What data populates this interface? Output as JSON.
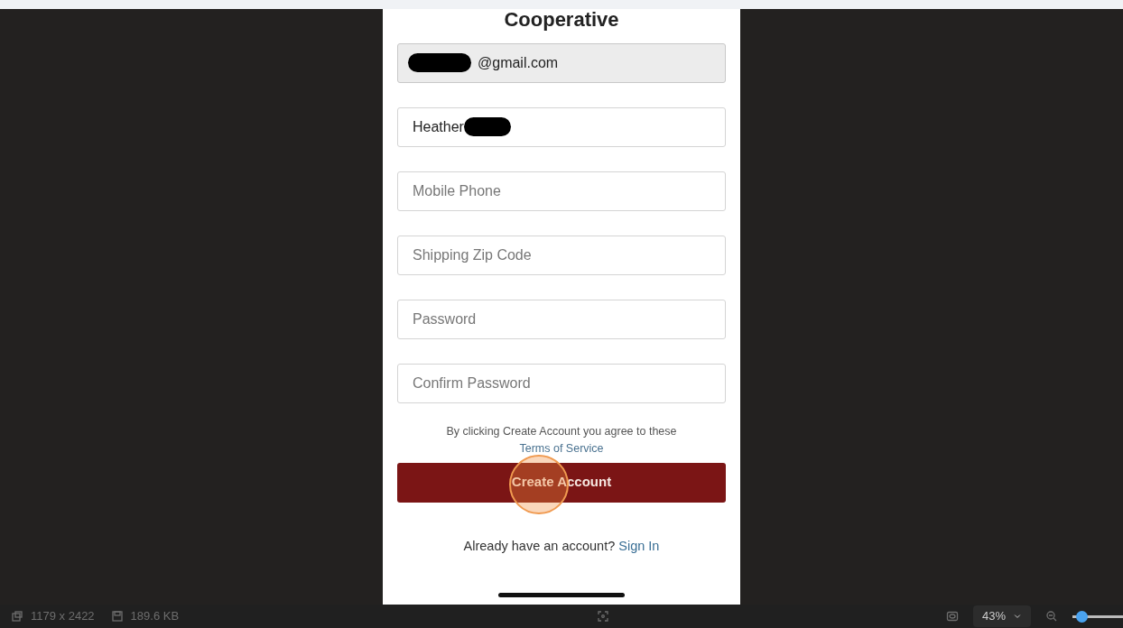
{
  "phone": {
    "title": "Cooperative",
    "fields": [
      {
        "kind": "redacted_prefix",
        "value": "@gmail.com",
        "disabled": true
      },
      {
        "kind": "redacted_suffix",
        "value": "Heather",
        "disabled": false
      },
      {
        "kind": "empty",
        "placeholder": "Mobile Phone",
        "disabled": false
      },
      {
        "kind": "empty",
        "placeholder": "Shipping Zip Code",
        "disabled": false
      },
      {
        "kind": "empty",
        "placeholder": "Password",
        "disabled": false
      },
      {
        "kind": "empty",
        "placeholder": "Confirm Password",
        "disabled": false
      }
    ],
    "agreement": "By clicking Create Account you agree to these",
    "terms_link": "Terms of Service",
    "create_button": "Create Account",
    "signin_prompt": "Already have an account?",
    "signin_link": "Sign In"
  },
  "status_bar": {
    "dimensions": "1179 x 2422",
    "file_size": "189.6 KB",
    "zoom": "43%",
    "zoom_slider": {
      "level": 0.08
    }
  }
}
